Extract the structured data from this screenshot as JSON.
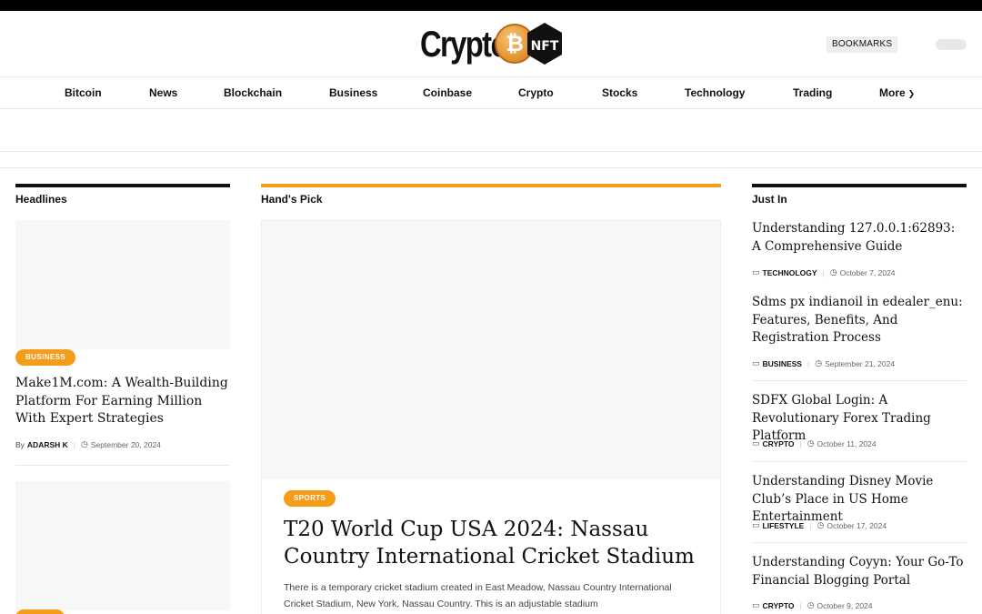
{
  "header": {
    "logo_text": "Crypto",
    "logo_coin_glyph": "₿",
    "logo_badge": "NFT",
    "bookmarks_label": "BOOKMARKS"
  },
  "nav": {
    "items": [
      "Bitcoin",
      "News",
      "Blockchain",
      "Business",
      "Coinbase",
      "Crypto",
      "Stocks",
      "Technology",
      "Trading",
      "More"
    ]
  },
  "columns": {
    "headlines": "Headlines",
    "hands_pick": "Hand's Pick",
    "just_in": "Just In"
  },
  "headlines": {
    "items": [
      {
        "category": "BUSINESS",
        "title": "Make1M.com: A Wealth-Building Platform For Earning Million With Expert Strategies",
        "by": "By",
        "author": "ADARSH K",
        "date": "September 20, 2024"
      }
    ]
  },
  "hands_pick": {
    "category": "SPORTS",
    "title": "T20 World Cup USA 2024: Nassau Country International Cricket Stadium",
    "excerpt": " There is a temporary cricket stadium created in East Meadow, Nassau Country International Cricket Stadium, New York, Nassau Country. This is an adjustable stadium"
  },
  "just_in": {
    "items": [
      {
        "title": "Understanding 127.0.0.1:62893: A Comprehensive Guide",
        "category": "TECHNOLOGY",
        "date": "October 7, 2024"
      },
      {
        "title": "Sdms px indianoil in edealer_enu: Features, Benefits, And Registration Process",
        "category": "BUSINESS",
        "date": "September 21, 2024"
      },
      {
        "title": "SDFX Global Login: A Revolutionary Forex Trading Platform",
        "category": "CRYPTO",
        "date": "October 11, 2024"
      },
      {
        "title": "Understanding Disney Movie Club’s Place in US Home Entertainment",
        "category": "LIFESTYLE",
        "date": "October 17, 2024"
      },
      {
        "title": "Understanding Coyyn: Your Go-To Financial Blogging Portal",
        "category": "CRYPTO",
        "date": "October 9, 2024"
      }
    ]
  },
  "colors": {
    "accent": "#f59c1a",
    "text": "#111111",
    "placeholder": "#f7f7f7"
  }
}
